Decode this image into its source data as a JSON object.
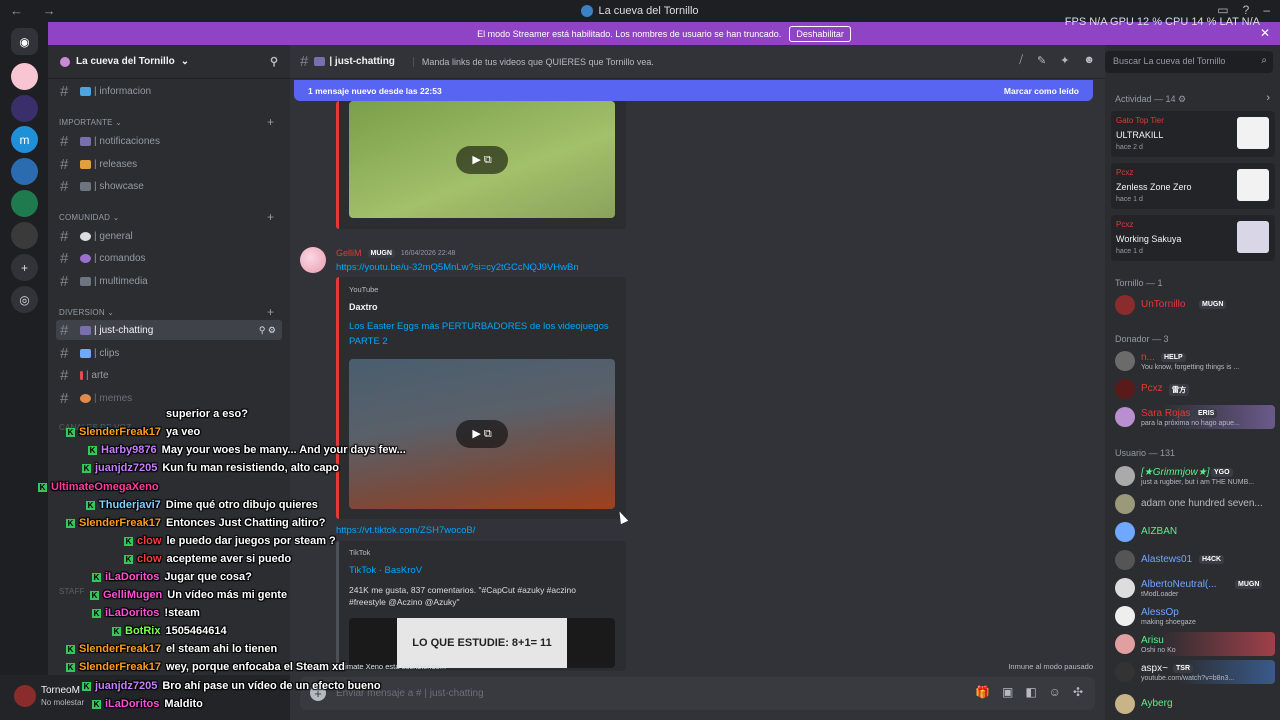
{
  "window": {
    "title": "La cueva del Tornillo",
    "stats": "FPS N/A GPU 12 % CPU 14 % LAT N/A"
  },
  "banner": {
    "text": "El modo Streamer está habilitado. Los nombres de usuario se han truncado.",
    "button": "Deshabilitar"
  },
  "server": {
    "name": "La cueva del Tornillo",
    "channels": [
      {
        "name": "| informacion"
      },
      {
        "name": "| notificaciones"
      },
      {
        "name": "| releases"
      },
      {
        "name": "| showcase"
      },
      {
        "name": "| general"
      },
      {
        "name": "| comandos"
      },
      {
        "name": "| multimedia"
      },
      {
        "name": "| just-chatting"
      },
      {
        "name": "| clips"
      },
      {
        "name": "| arte"
      },
      {
        "name": "| memes"
      }
    ],
    "categories": [
      "IMPORTANTE",
      "COMUNIDAD",
      "DIVERSION",
      "CANALES DE VOZ",
      "STAFF"
    ]
  },
  "user_panel": {
    "name": "TorneoM",
    "status": "No molestar"
  },
  "channel": {
    "name": "| just-chatting",
    "topic": "Manda links de tus videos que QUIERES que Tornillo vea.",
    "new_messages": "1 mensaje nuevo desde las 22:53",
    "mark_read": "Marcar como leído",
    "composer_placeholder": "Enviar mensaje a # | just-chatting",
    "typing": "Ultimate Xeno está escribiendo...",
    "slowmode": "Inmune al modo pausado"
  },
  "message": {
    "author": "GelliM",
    "badge": "MUGN",
    "timestamp": "16/04/2026 22:48",
    "link1": "https://youtu.be/u-32mQ5MnLw?si=cy2tGCcNQJ9VHwBn",
    "embed1": {
      "provider": "YouTube",
      "author": "Daxtro",
      "title": "Los Easter Eggs más PERTURBADORES de los videojuegos PARTE 2"
    },
    "link2": "https://vt.tiktok.com/ZSH7wocoB/",
    "embed2": {
      "provider": "TikTok",
      "title": "TikTok · BasKroV",
      "description": "241K me gusta, 837 comentarios. \"#CapCut #azuky #aczino #freestyle @Aczino @Azuky\"",
      "thumb_text": "LO QUE ESTUDIE: 8+1= 11"
    }
  },
  "members": {
    "search_placeholder": "Buscar La cueva del Tornillo",
    "activity_header": "Actividad — 14",
    "activities": [
      {
        "who": "Gato Top Tier",
        "game": "ULTRAKILL",
        "when": "hace 2 d"
      },
      {
        "who": "Pcxz",
        "game": "Zenless Zone Zero",
        "when": "hace 1 d"
      },
      {
        "who": "Pcxz",
        "game": "Working Sakuya",
        "when": "hace 1 d"
      }
    ],
    "groups": [
      {
        "header": "Tornillo — 1"
      },
      {
        "header": "Donador — 3"
      },
      {
        "header": "Usuario — 131"
      }
    ],
    "list": [
      {
        "name": "UnTornillo",
        "status": "",
        "badge": "MUGN",
        "color": "#e53935"
      },
      {
        "name": "n...",
        "status": "You know, forgetting things is ...",
        "badge": "HELP",
        "color": "#e53935"
      },
      {
        "name": "Pcxz",
        "status": "",
        "badge": "雷方",
        "color": "#e53935"
      },
      {
        "name": "Sara Rojas",
        "status": "para la próxima no hago apue...",
        "badge": "ERIS",
        "color": "#e53935"
      },
      {
        "name": "[★Grimmjow★]",
        "status": "just a rugbier, but i am THE NUMB...",
        "badge": "YGO",
        "color": "#57f287"
      },
      {
        "name": "adam one hundred seven...",
        "status": "",
        "badge": "",
        "color": "#b5bac1"
      },
      {
        "name": "AIZBAN",
        "status": "",
        "badge": "",
        "color": "#57f287"
      },
      {
        "name": "Alastews01",
        "status": "",
        "badge": "H4CK",
        "color": "#6fa8ff"
      },
      {
        "name": "AlbertoNeutral(...",
        "status": "tModLoader",
        "badge": "MUGN",
        "color": "#6fa8ff"
      },
      {
        "name": "AlessOp",
        "status": "making shoegaze",
        "badge": "",
        "color": "#6fa8ff"
      },
      {
        "name": "Arisu",
        "status": "Oshi no Ko",
        "badge": "",
        "color": "#57f287"
      },
      {
        "name": "aspx~",
        "status": "youtube.com/watch?v=b8n3...",
        "badge": "TSR",
        "color": "#f2f3f5"
      },
      {
        "name": "Ayberg",
        "status": "",
        "badge": "",
        "color": "#57f287"
      }
    ]
  },
  "stream_chat": [
    {
      "user": "",
      "text": "superior a eso?",
      "color": "#ffffff"
    },
    {
      "user": "SlenderFreak17",
      "text": "ya veo",
      "color": "#ff9f1a"
    },
    {
      "user": "Harby9876",
      "text": "May your woes be many... And your days few...",
      "color": "#c77dff"
    },
    {
      "user": "juanjdz7205",
      "text": "Kun fu man resistiendo, alto capo",
      "color": "#c77dff"
    },
    {
      "user": "UltimateOmegaXeno",
      "text": "",
      "color": "#ff3ba0"
    },
    {
      "user": "Thuderjavi7",
      "text": "Dime qué otro dibujo quieres",
      "color": "#7fd3ff"
    },
    {
      "user": "SlenderFreak17",
      "text": "Entonces Just Chatting altiro?",
      "color": "#ff9f1a"
    },
    {
      "user": "clow",
      "text": "le puedo dar juegos por steam ?",
      "color": "#ff3b3b"
    },
    {
      "user": "clow",
      "text": "acepteme aver si puedo",
      "color": "#ff3b3b"
    },
    {
      "user": "iLaDoritos",
      "text": "Jugar que cosa?",
      "color": "#ff4fd8"
    },
    {
      "user": "GelliMugen",
      "text": "Un vídeo más mi gente",
      "color": "#ff4fd8"
    },
    {
      "user": "iLaDoritos",
      "text": "!steam",
      "color": "#ff4fd8"
    },
    {
      "user": "BotRix",
      "text": "1505464614",
      "color": "#7cff4f"
    },
    {
      "user": "SlenderFreak17",
      "text": "el steam ahi lo tienen",
      "color": "#ff9f1a"
    },
    {
      "user": "SlenderFreak17",
      "text": "wey, porque enfocaba el Steam xd",
      "color": "#ff9f1a"
    },
    {
      "user": "juanjdz7205",
      "text": "Bro ahí pase un vídeo de un efecto bueno",
      "color": "#c77dff"
    },
    {
      "user": "iLaDoritos",
      "text": "Maldito",
      "color": "#ff4fd8"
    }
  ]
}
